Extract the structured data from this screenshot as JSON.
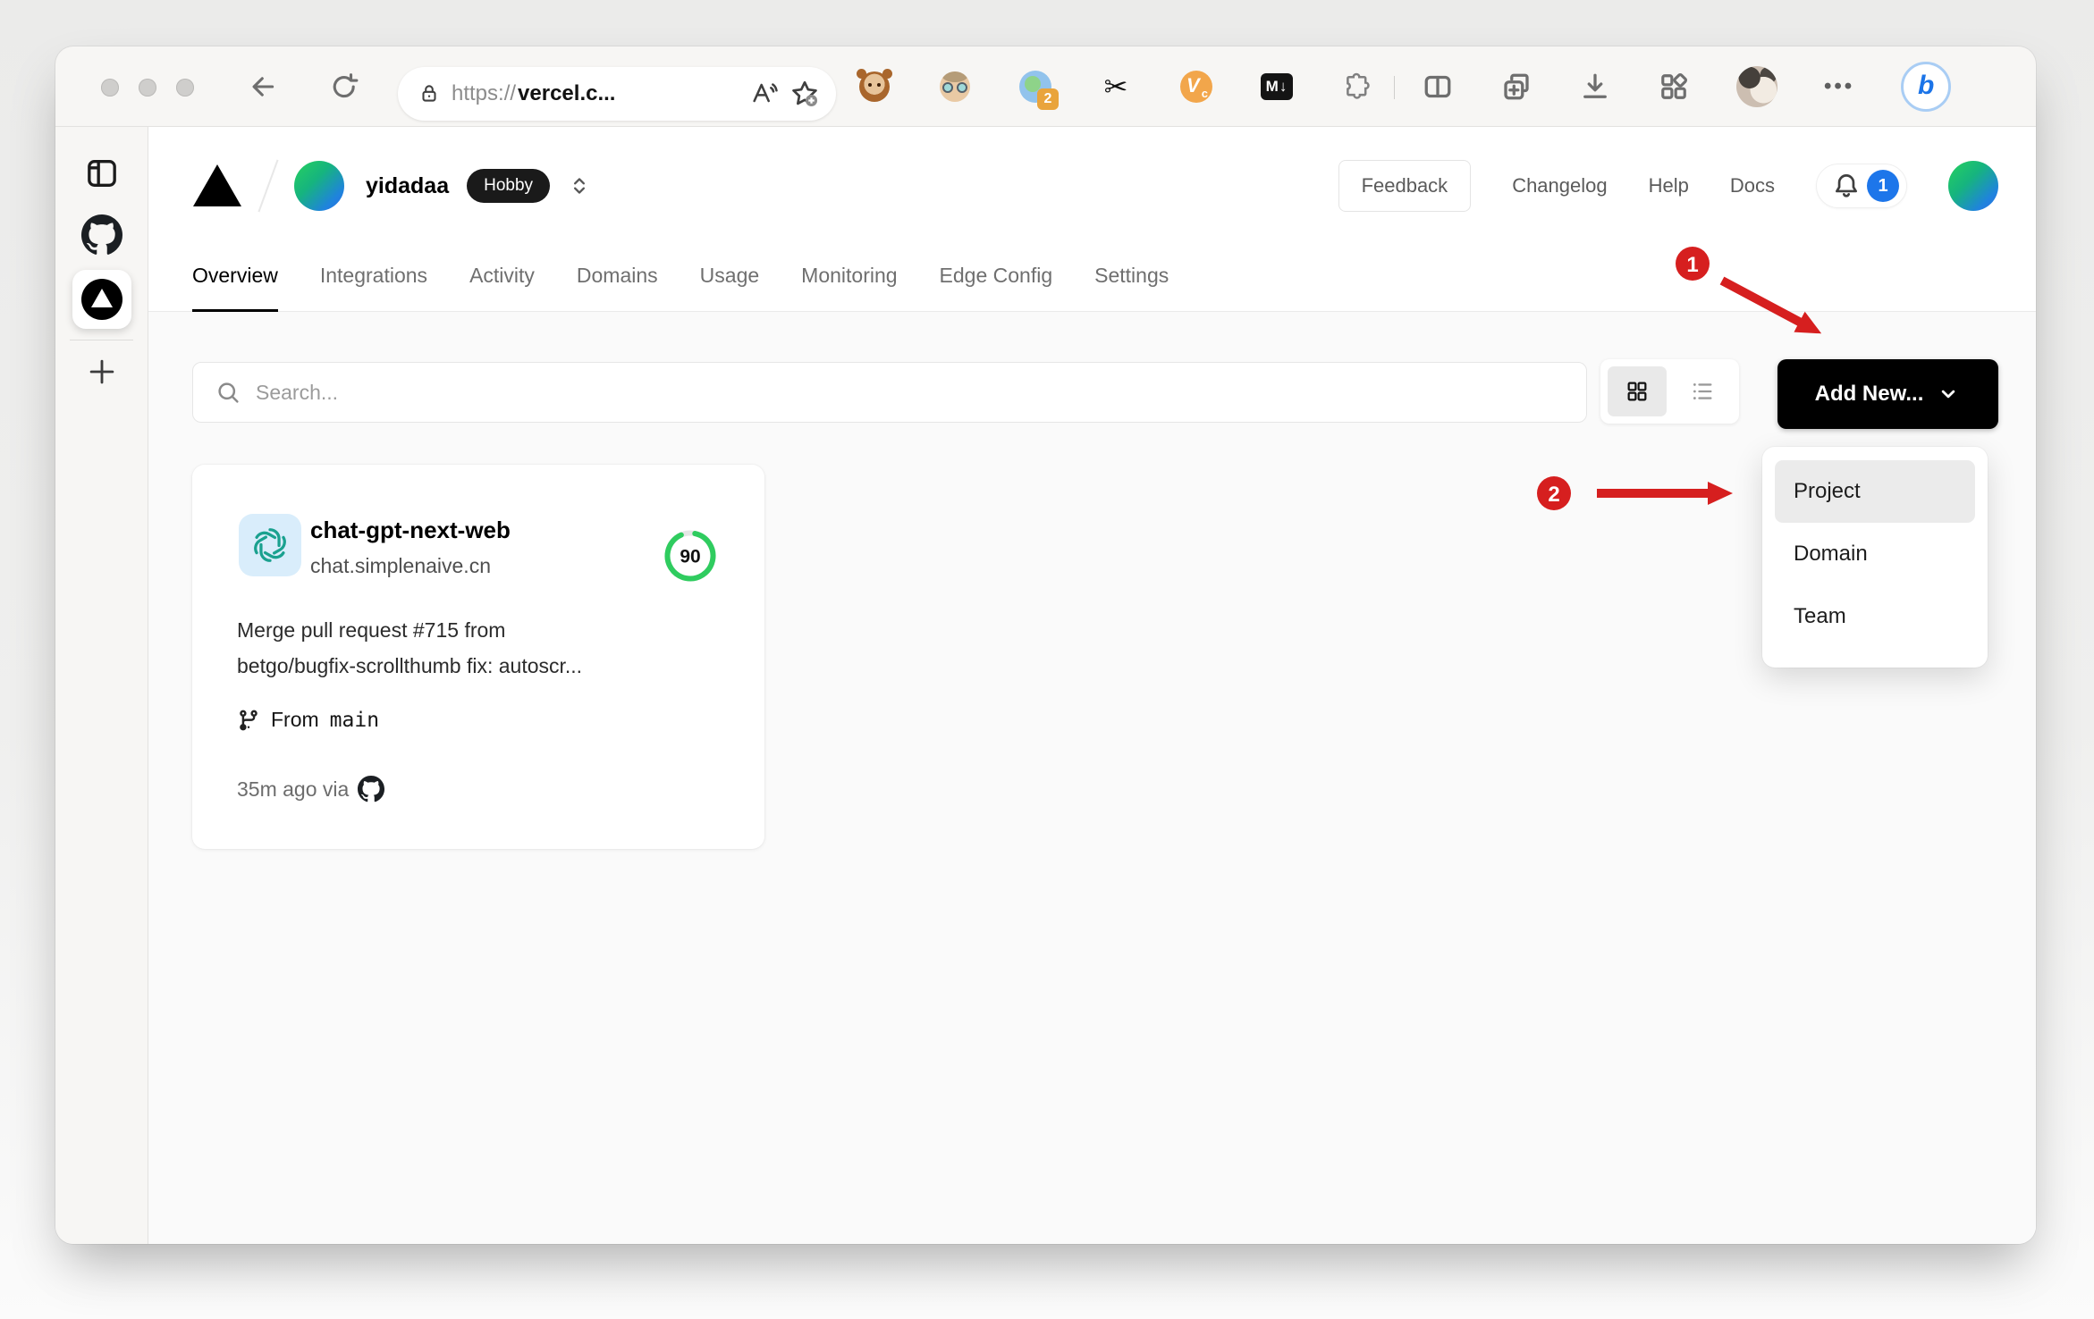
{
  "browser": {
    "url_scheme": "https://",
    "url_host": "vercel.c...",
    "extensions": {
      "scissors_glyph": "✂",
      "tab_manager_badge": "2",
      "vc_big": "V",
      "vc_small": "c",
      "markdown_label": "M↓",
      "more_dots": "•••",
      "bing_label": "b"
    }
  },
  "header": {
    "team_name": "yidadaa",
    "plan_badge": "Hobby",
    "feedback_label": "Feedback",
    "links": [
      "Changelog",
      "Help",
      "Docs"
    ],
    "notification_count": "1"
  },
  "tabs": [
    {
      "label": "Overview",
      "active": true
    },
    {
      "label": "Integrations",
      "active": false
    },
    {
      "label": "Activity",
      "active": false
    },
    {
      "label": "Domains",
      "active": false
    },
    {
      "label": "Usage",
      "active": false
    },
    {
      "label": "Monitoring",
      "active": false
    },
    {
      "label": "Edge Config",
      "active": false
    },
    {
      "label": "Settings",
      "active": false
    }
  ],
  "toolbar": {
    "search_placeholder": "Search...",
    "add_new_label": "Add New..."
  },
  "card": {
    "title": "chat-gpt-next-web",
    "domain": "chat.simplenaive.cn",
    "score": "90",
    "commit_line1": "Merge pull request #715 from",
    "commit_line2": "betgo/bugfix-scrollthumb fix: autoscr...",
    "branch_prefix": "From",
    "branch_name": "main",
    "deployed_text": "35m ago via"
  },
  "dropdown": {
    "items": [
      "Project",
      "Domain",
      "Team"
    ]
  },
  "annotations": {
    "step1": "1",
    "step2": "2"
  },
  "colors": {
    "annotation_red": "#d61f1f",
    "score_green": "#2fcc5f",
    "notification_blue": "#1d76ea",
    "avatar_gradient": [
      "#27d15e",
      "#2e6fe3"
    ]
  }
}
